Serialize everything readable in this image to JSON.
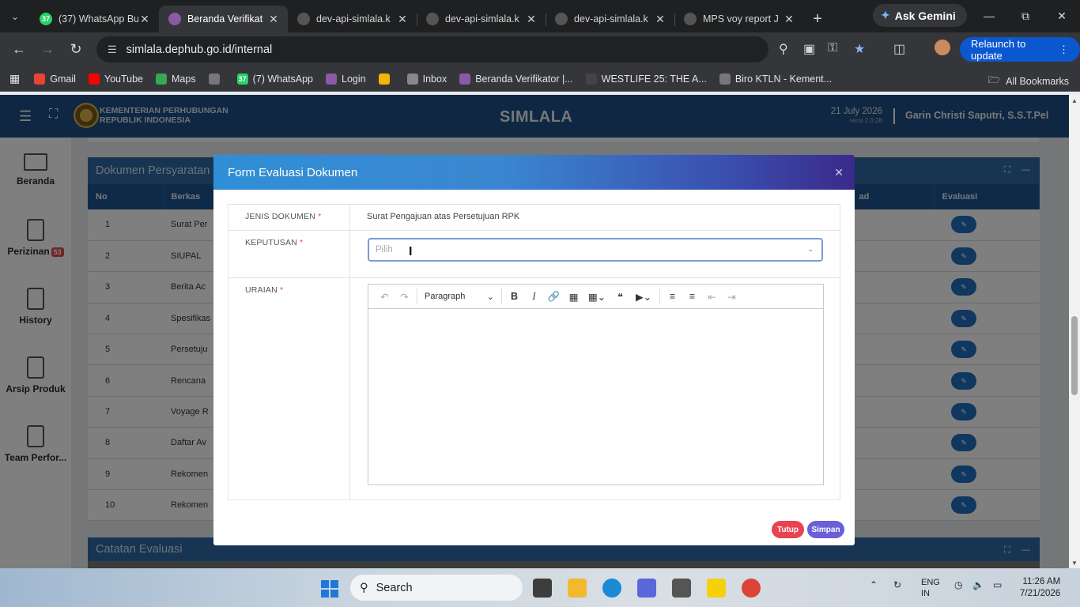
{
  "browser": {
    "tabs": [
      {
        "title": "(37) WhatsApp Bu",
        "badge": "37",
        "color": "#25d366"
      },
      {
        "title": "Beranda Verifikat",
        "color": "#8a5aa5"
      },
      {
        "title": "dev-api-simlala.k",
        "color": "#555"
      },
      {
        "title": "dev-api-simlala.k",
        "color": "#555"
      },
      {
        "title": "dev-api-simlala.k",
        "color": "#555"
      },
      {
        "title": "MPS voy report J",
        "color": "#555"
      }
    ],
    "gemini_label": "Ask Gemini",
    "url": "simlala.dephub.go.id/internal",
    "relaunch_label": "Relaunch to update",
    "bookmarks": [
      {
        "label": "Gmail",
        "color": "#ea4335"
      },
      {
        "label": "YouTube",
        "color": "#ff0000"
      },
      {
        "label": "Maps",
        "color": "#34a853"
      },
      {
        "label": "",
        "color": "#777"
      },
      {
        "label": "(7) WhatsApp",
        "badge": "37",
        "color": "#25d366"
      },
      {
        "label": "Login",
        "color": "#8a5aa5"
      },
      {
        "label": "",
        "color": "#f4b400"
      },
      {
        "label": "Inbox",
        "color": "#888"
      },
      {
        "label": "Beranda Verifikator |...",
        "color": "#8a5aa5"
      },
      {
        "label": "WESTLIFE 25: THE A...",
        "color": "#444"
      },
      {
        "label": "Biro KTLN - Kement...",
        "color": "#777"
      }
    ],
    "all_bookmarks": "All Bookmarks"
  },
  "header": {
    "ministry_line1": "KEMENTERIAN PERHUBUNGAN",
    "ministry_line2": "REPUBLIK INDONESIA",
    "app_title": "SIMLALA",
    "date": "21 July 2026",
    "version": "versi 2.0.28",
    "user": "Garin Christi Saputri, S.S.T.Pel"
  },
  "sidebar": {
    "items": [
      {
        "label": "Beranda"
      },
      {
        "label": "Perizinan",
        "badge": "53"
      },
      {
        "label": "History"
      },
      {
        "label": "Arsip Produk"
      },
      {
        "label": "Team Perfor..."
      }
    ]
  },
  "documents_card": {
    "title": "Dokumen Persyaratan",
    "columns": [
      "No",
      "Berkas",
      "ad",
      "Evaluasi"
    ],
    "rows": [
      {
        "no": "1",
        "berkas": "Surat Per"
      },
      {
        "no": "2",
        "berkas": "SIUPAL"
      },
      {
        "no": "3",
        "berkas": "Berita Ac"
      },
      {
        "no": "4",
        "berkas": "Spesifikas"
      },
      {
        "no": "5",
        "berkas": "Persetuju"
      },
      {
        "no": "6",
        "berkas": "Rencana"
      },
      {
        "no": "7",
        "berkas": "Voyage R"
      },
      {
        "no": "8",
        "berkas": "Daftar Av"
      },
      {
        "no": "9",
        "berkas": "Rekomen"
      },
      {
        "no": "10",
        "berkas": "Rekomen"
      }
    ]
  },
  "notes_card": {
    "title": "Catatan Evaluasi"
  },
  "modal": {
    "title": "Form Evaluasi Dokumen",
    "jenis_label": "JENIS DOKUMEN",
    "jenis_value": "Surat Pengajuan atas Persetujuan RPK",
    "keputusan_label": "KEPUTUSAN",
    "keputusan_placeholder": "Pilih",
    "uraian_label": "URAIAN",
    "editor": {
      "paragraph": "Paragraph"
    },
    "close_label": "Tutup",
    "save_label": "Simpan",
    "required_mark": "*"
  },
  "taskbar": {
    "search": "Search",
    "lang1": "ENG",
    "lang2": "IN",
    "time": "11:26 AM",
    "date": "7/21/2026"
  }
}
